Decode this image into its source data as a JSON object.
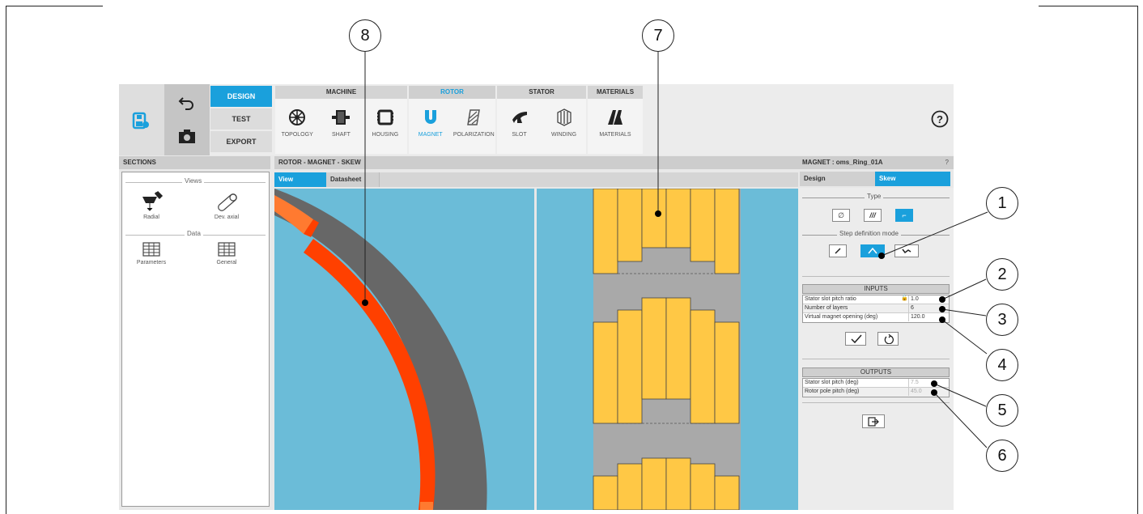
{
  "topbar": {
    "modes": [
      {
        "label": "DESIGN",
        "active": true
      },
      {
        "label": "TEST",
        "active": false
      },
      {
        "label": "EXPORT",
        "active": false
      }
    ],
    "groups": {
      "machine": {
        "title": "MACHINE",
        "items": [
          "TOPOLOGY",
          "SHAFT",
          "HOUSING"
        ]
      },
      "rotor": {
        "title": "ROTOR",
        "items": [
          "MAGNET",
          "POLARIZATION"
        ]
      },
      "stator": {
        "title": "STATOR",
        "items": [
          "SLOT",
          "WINDING"
        ]
      },
      "materials": {
        "title": "MATERIALS",
        "items": [
          "MATERIALS"
        ]
      }
    },
    "icons": {
      "save": "save-icon",
      "undo": "undo-icon",
      "camera": "camera-icon",
      "help": "help-icon"
    }
  },
  "sections": {
    "title": "SECTIONS",
    "views_label": "Views",
    "views": [
      "Radial",
      "Dev. axial"
    ],
    "data_label": "Data",
    "data": [
      "Parameters",
      "General"
    ]
  },
  "center": {
    "title": "ROTOR - MAGNET - SKEW",
    "tabs": [
      "View",
      "Datasheet"
    ],
    "colors": {
      "background": "#6bbcd8",
      "magnet": "#ff4000",
      "magnet_tip": "#ff7a30",
      "iron": "#676767",
      "yellow": "#ffc845"
    }
  },
  "right_panel": {
    "title": "MAGNET : oms_Ring_01A",
    "help": "?",
    "tabs": [
      "Design",
      "Skew"
    ],
    "type_label": "Type",
    "type_buttons": [
      "∅",
      "///",
      "⌐"
    ],
    "step_label": "Step definition mode",
    "inputs": {
      "header": "INPUTS",
      "rows": [
        {
          "key": "Stator slot pitch ratio",
          "value": "1.0"
        },
        {
          "key": "Number of layers",
          "value": "6"
        },
        {
          "key": "Virtual magnet opening  (deg)",
          "value": "120.0"
        }
      ]
    },
    "outputs": {
      "header": "OUTPUTS",
      "rows": [
        {
          "key": "Stator slot pitch (deg)",
          "value": "7.5"
        },
        {
          "key": "Rotor pole pitch (deg)",
          "value": "45.0"
        }
      ]
    }
  },
  "callouts": [
    "1",
    "2",
    "3",
    "4",
    "5",
    "6",
    "7",
    "8"
  ]
}
